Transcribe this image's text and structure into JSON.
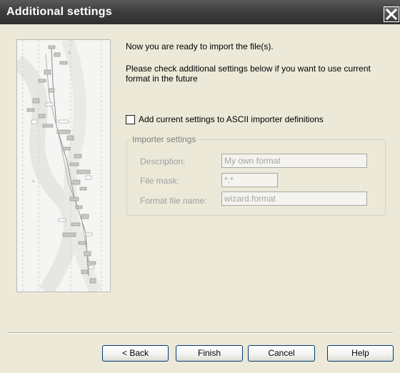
{
  "window": {
    "title": "Additional settings"
  },
  "content": {
    "intro_line1": "Now you are ready to import the file(s).",
    "intro_line2": "Please check additional settings below if you want to use current format in the future"
  },
  "checkbox": {
    "label": "Add current settings to ASCII importer definitions",
    "checked": false
  },
  "importer_settings": {
    "legend": "Importer settings",
    "description_label": "Description:",
    "description_value": "My own format",
    "file_mask_label": "File mask:",
    "file_mask_value": "*.*",
    "format_file_label": "Format file name:",
    "format_file_value": "wizard.format",
    "enabled": false
  },
  "buttons": {
    "back": "< Back",
    "finish": "Finish",
    "cancel": "Cancel",
    "help": "Help"
  },
  "icons": {
    "close": "close-icon",
    "wizard_picture": "candlestick-chart-picture"
  },
  "colors": {
    "titlebar": "#3c3c3c",
    "dialog_bg": "#ece9d8",
    "disabled_text": "#a0a0a0"
  }
}
